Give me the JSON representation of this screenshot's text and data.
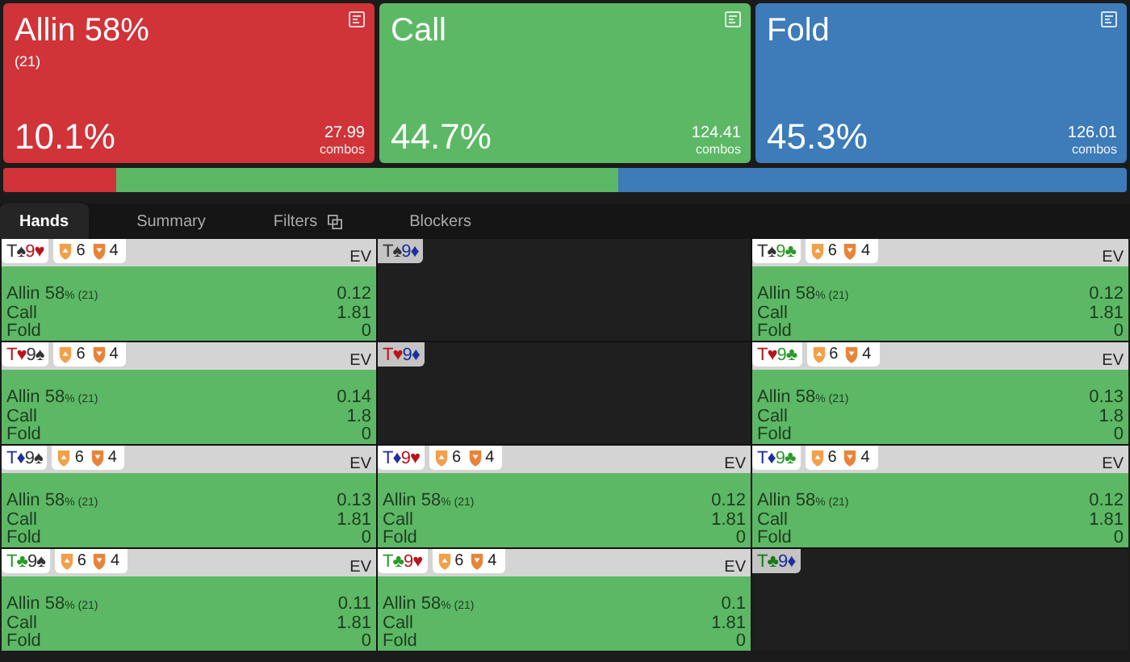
{
  "actions": [
    {
      "name": "Allin 58%",
      "detail": "(21)",
      "percent": "10.1%",
      "combos": "27.99",
      "combos_label": "combos",
      "color": "#d03338"
    },
    {
      "name": "Call",
      "percent": "44.7%",
      "combos": "124.41",
      "combos_label": "combos",
      "color": "#5cb865"
    },
    {
      "name": "Fold",
      "percent": "45.3%",
      "combos": "126.01",
      "combos_label": "combos",
      "color": "#3d7bb9"
    }
  ],
  "tabs": [
    {
      "label": "Hands",
      "selected": true
    },
    {
      "label": "Summary",
      "selected": false
    },
    {
      "label": "Filters",
      "selected": false,
      "kind": "copy"
    },
    {
      "label": "Blockers",
      "selected": false
    }
  ],
  "hands": [
    {
      "kind": "hand",
      "cards": [
        {
          "rank": "T",
          "suit": "♠",
          "color": "#333333"
        },
        {
          "rank": "9",
          "suit": "♥",
          "color": "#b8141c"
        }
      ],
      "blockers": [
        {
          "kind": "up",
          "count": "6"
        },
        {
          "kind": "down",
          "count": "4"
        }
      ],
      "ev_label": "EV",
      "lines": [
        {
          "label": "Allin 58",
          "note": "% (21)",
          "value": "0.12"
        },
        {
          "label": "Call",
          "value": "1.81"
        },
        {
          "label": "Fold",
          "value": "0"
        }
      ]
    },
    {
      "kind": "empty",
      "cards": [
        {
          "rank": "T",
          "suit": "♠",
          "color": "#333333"
        },
        {
          "rank": "9",
          "suit": "♦",
          "color": "#1d2f9e"
        }
      ]
    },
    {
      "kind": "hand",
      "cards": [
        {
          "rank": "T",
          "suit": "♠",
          "color": "#333333"
        },
        {
          "rank": "9",
          "suit": "♣",
          "color": "#2a9a2a"
        }
      ],
      "blockers": [
        {
          "kind": "up",
          "count": "6"
        },
        {
          "kind": "down",
          "count": "4"
        }
      ],
      "ev_label": "EV",
      "lines": [
        {
          "label": "Allin 58",
          "note": "% (21)",
          "value": "0.12"
        },
        {
          "label": "Call",
          "value": "1.81"
        },
        {
          "label": "Fold",
          "value": "0"
        }
      ]
    },
    {
      "kind": "hand",
      "cards": [
        {
          "rank": "T",
          "suit": "♥",
          "color": "#b8141c"
        },
        {
          "rank": "9",
          "suit": "♠",
          "color": "#333333"
        }
      ],
      "blockers": [
        {
          "kind": "up",
          "count": "6"
        },
        {
          "kind": "down",
          "count": "4"
        }
      ],
      "ev_label": "EV",
      "lines": [
        {
          "label": "Allin 58",
          "note": "% (21)",
          "value": "0.14"
        },
        {
          "label": "Call",
          "value": "1.8"
        },
        {
          "label": "Fold",
          "value": "0"
        }
      ]
    },
    {
      "kind": "empty",
      "cards": [
        {
          "rank": "T",
          "suit": "♥",
          "color": "#b8141c"
        },
        {
          "rank": "9",
          "suit": "♦",
          "color": "#1d2f9e"
        }
      ]
    },
    {
      "kind": "hand",
      "cards": [
        {
          "rank": "T",
          "suit": "♥",
          "color": "#b8141c"
        },
        {
          "rank": "9",
          "suit": "♣",
          "color": "#2a9a2a"
        }
      ],
      "blockers": [
        {
          "kind": "up",
          "count": "6"
        },
        {
          "kind": "down",
          "count": "4"
        }
      ],
      "ev_label": "EV",
      "lines": [
        {
          "label": "Allin 58",
          "note": "% (21)",
          "value": "0.13"
        },
        {
          "label": "Call",
          "value": "1.8"
        },
        {
          "label": "Fold",
          "value": "0"
        }
      ]
    },
    {
      "kind": "hand",
      "cards": [
        {
          "rank": "T",
          "suit": "♦",
          "color": "#1d2f9e"
        },
        {
          "rank": "9",
          "suit": "♠",
          "color": "#333333"
        }
      ],
      "blockers": [
        {
          "kind": "up",
          "count": "6"
        },
        {
          "kind": "down",
          "count": "4"
        }
      ],
      "ev_label": "EV",
      "lines": [
        {
          "label": "Allin 58",
          "note": "% (21)",
          "value": "0.13"
        },
        {
          "label": "Call",
          "value": "1.81"
        },
        {
          "label": "Fold",
          "value": "0"
        }
      ]
    },
    {
      "kind": "hand",
      "cards": [
        {
          "rank": "T",
          "suit": "♦",
          "color": "#1d2f9e"
        },
        {
          "rank": "9",
          "suit": "♥",
          "color": "#b8141c"
        }
      ],
      "blockers": [
        {
          "kind": "up",
          "count": "6"
        },
        {
          "kind": "down",
          "count": "4"
        }
      ],
      "ev_label": "EV",
      "lines": [
        {
          "label": "Allin 58",
          "note": "% (21)",
          "value": "0.12"
        },
        {
          "label": "Call",
          "value": "1.81"
        },
        {
          "label": "Fold",
          "value": "0"
        }
      ]
    },
    {
      "kind": "hand",
      "cards": [
        {
          "rank": "T",
          "suit": "♦",
          "color": "#1d2f9e"
        },
        {
          "rank": "9",
          "suit": "♣",
          "color": "#2a9a2a"
        }
      ],
      "blockers": [
        {
          "kind": "up",
          "count": "6"
        },
        {
          "kind": "down",
          "count": "4"
        }
      ],
      "ev_label": "EV",
      "lines": [
        {
          "label": "Allin 58",
          "note": "% (21)",
          "value": "0.12"
        },
        {
          "label": "Call",
          "value": "1.81"
        },
        {
          "label": "Fold",
          "value": "0"
        }
      ]
    },
    {
      "kind": "hand",
      "cards": [
        {
          "rank": "T",
          "suit": "♣",
          "color": "#2a9a2a"
        },
        {
          "rank": "9",
          "suit": "♠",
          "color": "#333333"
        }
      ],
      "blockers": [
        {
          "kind": "up",
          "count": "6"
        },
        {
          "kind": "down",
          "count": "4"
        }
      ],
      "ev_label": "EV",
      "lines": [
        {
          "label": "Allin 58",
          "note": "% (21)",
          "value": "0.11"
        },
        {
          "label": "Call",
          "value": "1.81"
        },
        {
          "label": "Fold",
          "value": "0"
        }
      ]
    },
    {
      "kind": "hand",
      "cards": [
        {
          "rank": "T",
          "suit": "♣",
          "color": "#2a9a2a"
        },
        {
          "rank": "9",
          "suit": "♥",
          "color": "#b8141c"
        }
      ],
      "blockers": [
        {
          "kind": "up",
          "count": "6"
        },
        {
          "kind": "down",
          "count": "4"
        }
      ],
      "ev_label": "EV",
      "lines": [
        {
          "label": "Allin 58",
          "note": "% (21)",
          "value": "0.1"
        },
        {
          "label": "Call",
          "value": "1.81"
        },
        {
          "label": "Fold",
          "value": "0"
        }
      ]
    },
    {
      "kind": "empty",
      "cards": [
        {
          "rank": "T",
          "suit": "♣",
          "color": "#157a15"
        },
        {
          "rank": "9",
          "suit": "♦",
          "color": "#1d2f9e"
        }
      ]
    }
  ]
}
